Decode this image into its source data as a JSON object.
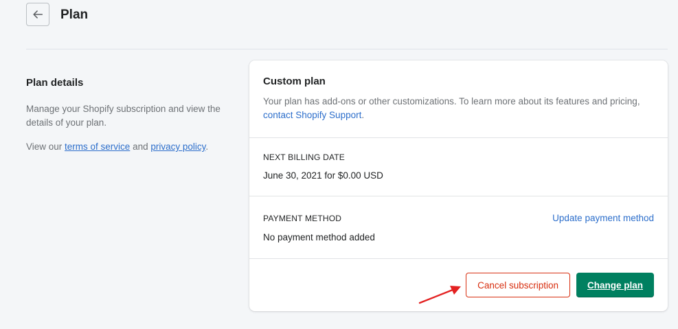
{
  "header": {
    "back_icon": "arrow-left-icon",
    "title": "Plan"
  },
  "annotation": {
    "title": "Plan details",
    "description": "Manage your Shopify subscription and view the details of your plan.",
    "links_prefix": "View our ",
    "terms_label": "terms of service",
    "links_and": " and ",
    "privacy_label": "privacy policy",
    "links_suffix": "."
  },
  "plan_card": {
    "plan_title": "Custom plan",
    "plan_description": "Your plan has add-ons or other customizations. To learn more about its features and pricing,",
    "support_link": "contact Shopify Support",
    "support_suffix": ".",
    "billing_heading": "NEXT BILLING DATE",
    "billing_value": "June 30, 2021 for $0.00 USD",
    "payment_heading": "PAYMENT METHOD",
    "update_payment_label": "Update payment method",
    "payment_value": "No payment method added",
    "cancel_label": "Cancel subscription",
    "change_label": "Change plan"
  },
  "colors": {
    "background": "#f4f6f8",
    "primary_button": "#008060",
    "critical": "#d72c0d",
    "link": "#2c6ecb",
    "annotation_arrow": "#e32222"
  }
}
